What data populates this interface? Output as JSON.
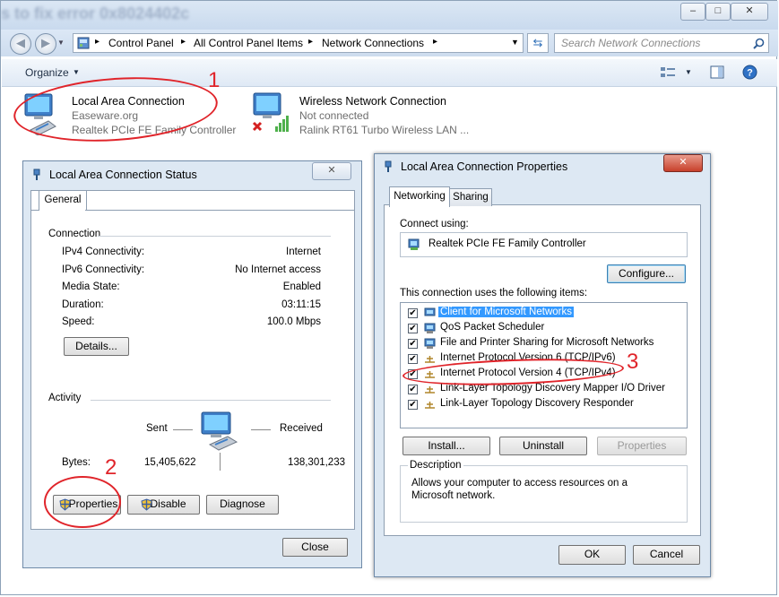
{
  "explorer": {
    "blurred_title": "s to fix error 0x8024402c",
    "caption_buttons": {
      "minimize": "–",
      "maximize": "□",
      "close": "✕"
    },
    "breadcrumb": [
      "Control Panel",
      "All Control Panel Items",
      "Network Connections"
    ],
    "search_placeholder": "Search Network Connections",
    "organize_label": "Organize",
    "connections": [
      {
        "name": "Local Area Connection",
        "network": "Easeware.org",
        "adapter": "Realtek PCIe FE Family Controller"
      },
      {
        "name": "Wireless Network Connection",
        "network": "Not connected",
        "adapter": "Ralink RT61 Turbo Wireless LAN ..."
      }
    ]
  },
  "annotations": [
    "1",
    "2",
    "3"
  ],
  "status_dialog": {
    "title": "Local Area Connection Status",
    "tab": "General",
    "connection_heading": "Connection",
    "rows": [
      {
        "label": "IPv4 Connectivity:",
        "value": "Internet"
      },
      {
        "label": "IPv6 Connectivity:",
        "value": "No Internet access"
      },
      {
        "label": "Media State:",
        "value": "Enabled"
      },
      {
        "label": "Duration:",
        "value": "03:11:15"
      },
      {
        "label": "Speed:",
        "value": "100.0 Mbps"
      }
    ],
    "details_button": "Details...",
    "activity_heading": "Activity",
    "sent_label": "Sent",
    "received_label": "Received",
    "bytes_label": "Bytes:",
    "bytes_sent": "15,405,622",
    "bytes_received": "138,301,233",
    "properties_button": "Properties",
    "disable_button": "Disable",
    "diagnose_button": "Diagnose",
    "close_button": "Close"
  },
  "properties_dialog": {
    "title": "Local Area Connection Properties",
    "tabs": [
      "Networking",
      "Sharing"
    ],
    "connect_using_label": "Connect using:",
    "adapter": "Realtek PCIe FE Family Controller",
    "configure_button": "Configure...",
    "items_label": "This connection uses the following items:",
    "items": [
      {
        "label": "Client for Microsoft Networks",
        "checked": true,
        "selected": true
      },
      {
        "label": "QoS Packet Scheduler",
        "checked": true,
        "selected": false
      },
      {
        "label": "File and Printer Sharing for Microsoft Networks",
        "checked": true,
        "selected": false
      },
      {
        "label": "Internet Protocol Version 6 (TCP/IPv6)",
        "checked": true,
        "selected": false
      },
      {
        "label": "Internet Protocol Version 4 (TCP/IPv4)",
        "checked": true,
        "selected": false
      },
      {
        "label": "Link-Layer Topology Discovery Mapper I/O Driver",
        "checked": true,
        "selected": false
      },
      {
        "label": "Link-Layer Topology Discovery Responder",
        "checked": true,
        "selected": false
      }
    ],
    "install_button": "Install...",
    "uninstall_button": "Uninstall",
    "properties_button": "Properties",
    "description_heading": "Description",
    "description_text": "Allows your computer to access resources on a Microsoft network.",
    "ok_button": "OK",
    "cancel_button": "Cancel"
  },
  "colors": {
    "annotation": "#e0242a",
    "selection": "#3399ff",
    "link": "#1e3287"
  }
}
